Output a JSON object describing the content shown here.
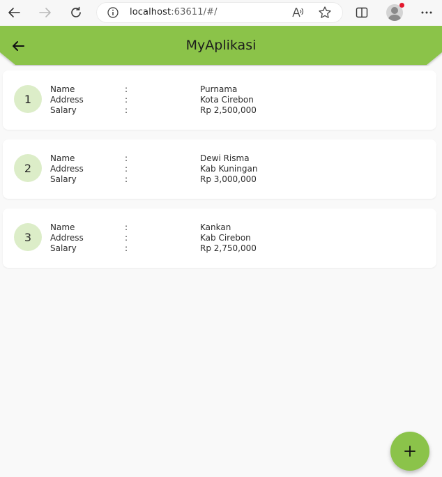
{
  "browser": {
    "url_host": "localhost",
    "url_rest": ":63611/#/"
  },
  "app": {
    "title": "MyAplikasi",
    "accent": "#8bc34a",
    "circle_color": "#dcedc8"
  },
  "fields": {
    "name": "Name",
    "address": "Address",
    "salary": "Salary",
    "colon": ":"
  },
  "employees": [
    {
      "no": "1",
      "name": "Purnama",
      "address": "Kota Cirebon",
      "salary": "Rp 2,500,000"
    },
    {
      "no": "2",
      "name": "Dewi Risma",
      "address": "Kab Kuningan",
      "salary": "Rp 3,000,000"
    },
    {
      "no": "3",
      "name": "Kankan",
      "address": "Kab Cirebon",
      "salary": "Rp 2,750,000"
    }
  ],
  "fab": {
    "icon": "plus-icon"
  }
}
